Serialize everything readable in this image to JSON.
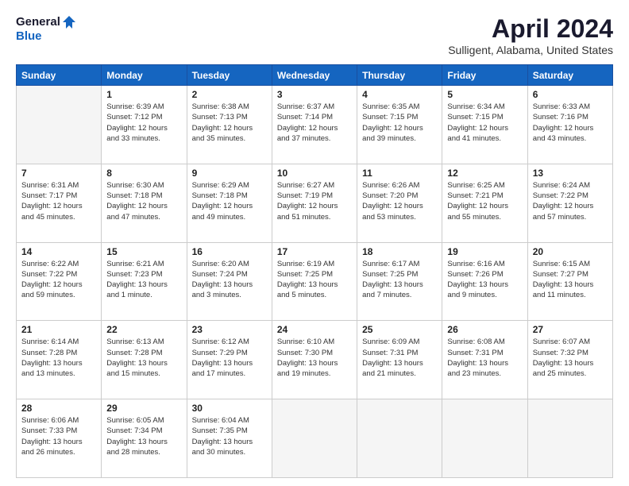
{
  "logo": {
    "general": "General",
    "blue": "Blue"
  },
  "title": "April 2024",
  "subtitle": "Sulligent, Alabama, United States",
  "headers": [
    "Sunday",
    "Monday",
    "Tuesday",
    "Wednesday",
    "Thursday",
    "Friday",
    "Saturday"
  ],
  "weeks": [
    [
      {
        "num": "",
        "sunrise": "",
        "sunset": "",
        "daylight": ""
      },
      {
        "num": "1",
        "sunrise": "Sunrise: 6:39 AM",
        "sunset": "Sunset: 7:12 PM",
        "daylight": "Daylight: 12 hours and 33 minutes."
      },
      {
        "num": "2",
        "sunrise": "Sunrise: 6:38 AM",
        "sunset": "Sunset: 7:13 PM",
        "daylight": "Daylight: 12 hours and 35 minutes."
      },
      {
        "num": "3",
        "sunrise": "Sunrise: 6:37 AM",
        "sunset": "Sunset: 7:14 PM",
        "daylight": "Daylight: 12 hours and 37 minutes."
      },
      {
        "num": "4",
        "sunrise": "Sunrise: 6:35 AM",
        "sunset": "Sunset: 7:15 PM",
        "daylight": "Daylight: 12 hours and 39 minutes."
      },
      {
        "num": "5",
        "sunrise": "Sunrise: 6:34 AM",
        "sunset": "Sunset: 7:15 PM",
        "daylight": "Daylight: 12 hours and 41 minutes."
      },
      {
        "num": "6",
        "sunrise": "Sunrise: 6:33 AM",
        "sunset": "Sunset: 7:16 PM",
        "daylight": "Daylight: 12 hours and 43 minutes."
      }
    ],
    [
      {
        "num": "7",
        "sunrise": "Sunrise: 6:31 AM",
        "sunset": "Sunset: 7:17 PM",
        "daylight": "Daylight: 12 hours and 45 minutes."
      },
      {
        "num": "8",
        "sunrise": "Sunrise: 6:30 AM",
        "sunset": "Sunset: 7:18 PM",
        "daylight": "Daylight: 12 hours and 47 minutes."
      },
      {
        "num": "9",
        "sunrise": "Sunrise: 6:29 AM",
        "sunset": "Sunset: 7:18 PM",
        "daylight": "Daylight: 12 hours and 49 minutes."
      },
      {
        "num": "10",
        "sunrise": "Sunrise: 6:27 AM",
        "sunset": "Sunset: 7:19 PM",
        "daylight": "Daylight: 12 hours and 51 minutes."
      },
      {
        "num": "11",
        "sunrise": "Sunrise: 6:26 AM",
        "sunset": "Sunset: 7:20 PM",
        "daylight": "Daylight: 12 hours and 53 minutes."
      },
      {
        "num": "12",
        "sunrise": "Sunrise: 6:25 AM",
        "sunset": "Sunset: 7:21 PM",
        "daylight": "Daylight: 12 hours and 55 minutes."
      },
      {
        "num": "13",
        "sunrise": "Sunrise: 6:24 AM",
        "sunset": "Sunset: 7:22 PM",
        "daylight": "Daylight: 12 hours and 57 minutes."
      }
    ],
    [
      {
        "num": "14",
        "sunrise": "Sunrise: 6:22 AM",
        "sunset": "Sunset: 7:22 PM",
        "daylight": "Daylight: 12 hours and 59 minutes."
      },
      {
        "num": "15",
        "sunrise": "Sunrise: 6:21 AM",
        "sunset": "Sunset: 7:23 PM",
        "daylight": "Daylight: 13 hours and 1 minute."
      },
      {
        "num": "16",
        "sunrise": "Sunrise: 6:20 AM",
        "sunset": "Sunset: 7:24 PM",
        "daylight": "Daylight: 13 hours and 3 minutes."
      },
      {
        "num": "17",
        "sunrise": "Sunrise: 6:19 AM",
        "sunset": "Sunset: 7:25 PM",
        "daylight": "Daylight: 13 hours and 5 minutes."
      },
      {
        "num": "18",
        "sunrise": "Sunrise: 6:17 AM",
        "sunset": "Sunset: 7:25 PM",
        "daylight": "Daylight: 13 hours and 7 minutes."
      },
      {
        "num": "19",
        "sunrise": "Sunrise: 6:16 AM",
        "sunset": "Sunset: 7:26 PM",
        "daylight": "Daylight: 13 hours and 9 minutes."
      },
      {
        "num": "20",
        "sunrise": "Sunrise: 6:15 AM",
        "sunset": "Sunset: 7:27 PM",
        "daylight": "Daylight: 13 hours and 11 minutes."
      }
    ],
    [
      {
        "num": "21",
        "sunrise": "Sunrise: 6:14 AM",
        "sunset": "Sunset: 7:28 PM",
        "daylight": "Daylight: 13 hours and 13 minutes."
      },
      {
        "num": "22",
        "sunrise": "Sunrise: 6:13 AM",
        "sunset": "Sunset: 7:28 PM",
        "daylight": "Daylight: 13 hours and 15 minutes."
      },
      {
        "num": "23",
        "sunrise": "Sunrise: 6:12 AM",
        "sunset": "Sunset: 7:29 PM",
        "daylight": "Daylight: 13 hours and 17 minutes."
      },
      {
        "num": "24",
        "sunrise": "Sunrise: 6:10 AM",
        "sunset": "Sunset: 7:30 PM",
        "daylight": "Daylight: 13 hours and 19 minutes."
      },
      {
        "num": "25",
        "sunrise": "Sunrise: 6:09 AM",
        "sunset": "Sunset: 7:31 PM",
        "daylight": "Daylight: 13 hours and 21 minutes."
      },
      {
        "num": "26",
        "sunrise": "Sunrise: 6:08 AM",
        "sunset": "Sunset: 7:31 PM",
        "daylight": "Daylight: 13 hours and 23 minutes."
      },
      {
        "num": "27",
        "sunrise": "Sunrise: 6:07 AM",
        "sunset": "Sunset: 7:32 PM",
        "daylight": "Daylight: 13 hours and 25 minutes."
      }
    ],
    [
      {
        "num": "28",
        "sunrise": "Sunrise: 6:06 AM",
        "sunset": "Sunset: 7:33 PM",
        "daylight": "Daylight: 13 hours and 26 minutes."
      },
      {
        "num": "29",
        "sunrise": "Sunrise: 6:05 AM",
        "sunset": "Sunset: 7:34 PM",
        "daylight": "Daylight: 13 hours and 28 minutes."
      },
      {
        "num": "30",
        "sunrise": "Sunrise: 6:04 AM",
        "sunset": "Sunset: 7:35 PM",
        "daylight": "Daylight: 13 hours and 30 minutes."
      },
      {
        "num": "",
        "sunrise": "",
        "sunset": "",
        "daylight": ""
      },
      {
        "num": "",
        "sunrise": "",
        "sunset": "",
        "daylight": ""
      },
      {
        "num": "",
        "sunrise": "",
        "sunset": "",
        "daylight": ""
      },
      {
        "num": "",
        "sunrise": "",
        "sunset": "",
        "daylight": ""
      }
    ]
  ]
}
